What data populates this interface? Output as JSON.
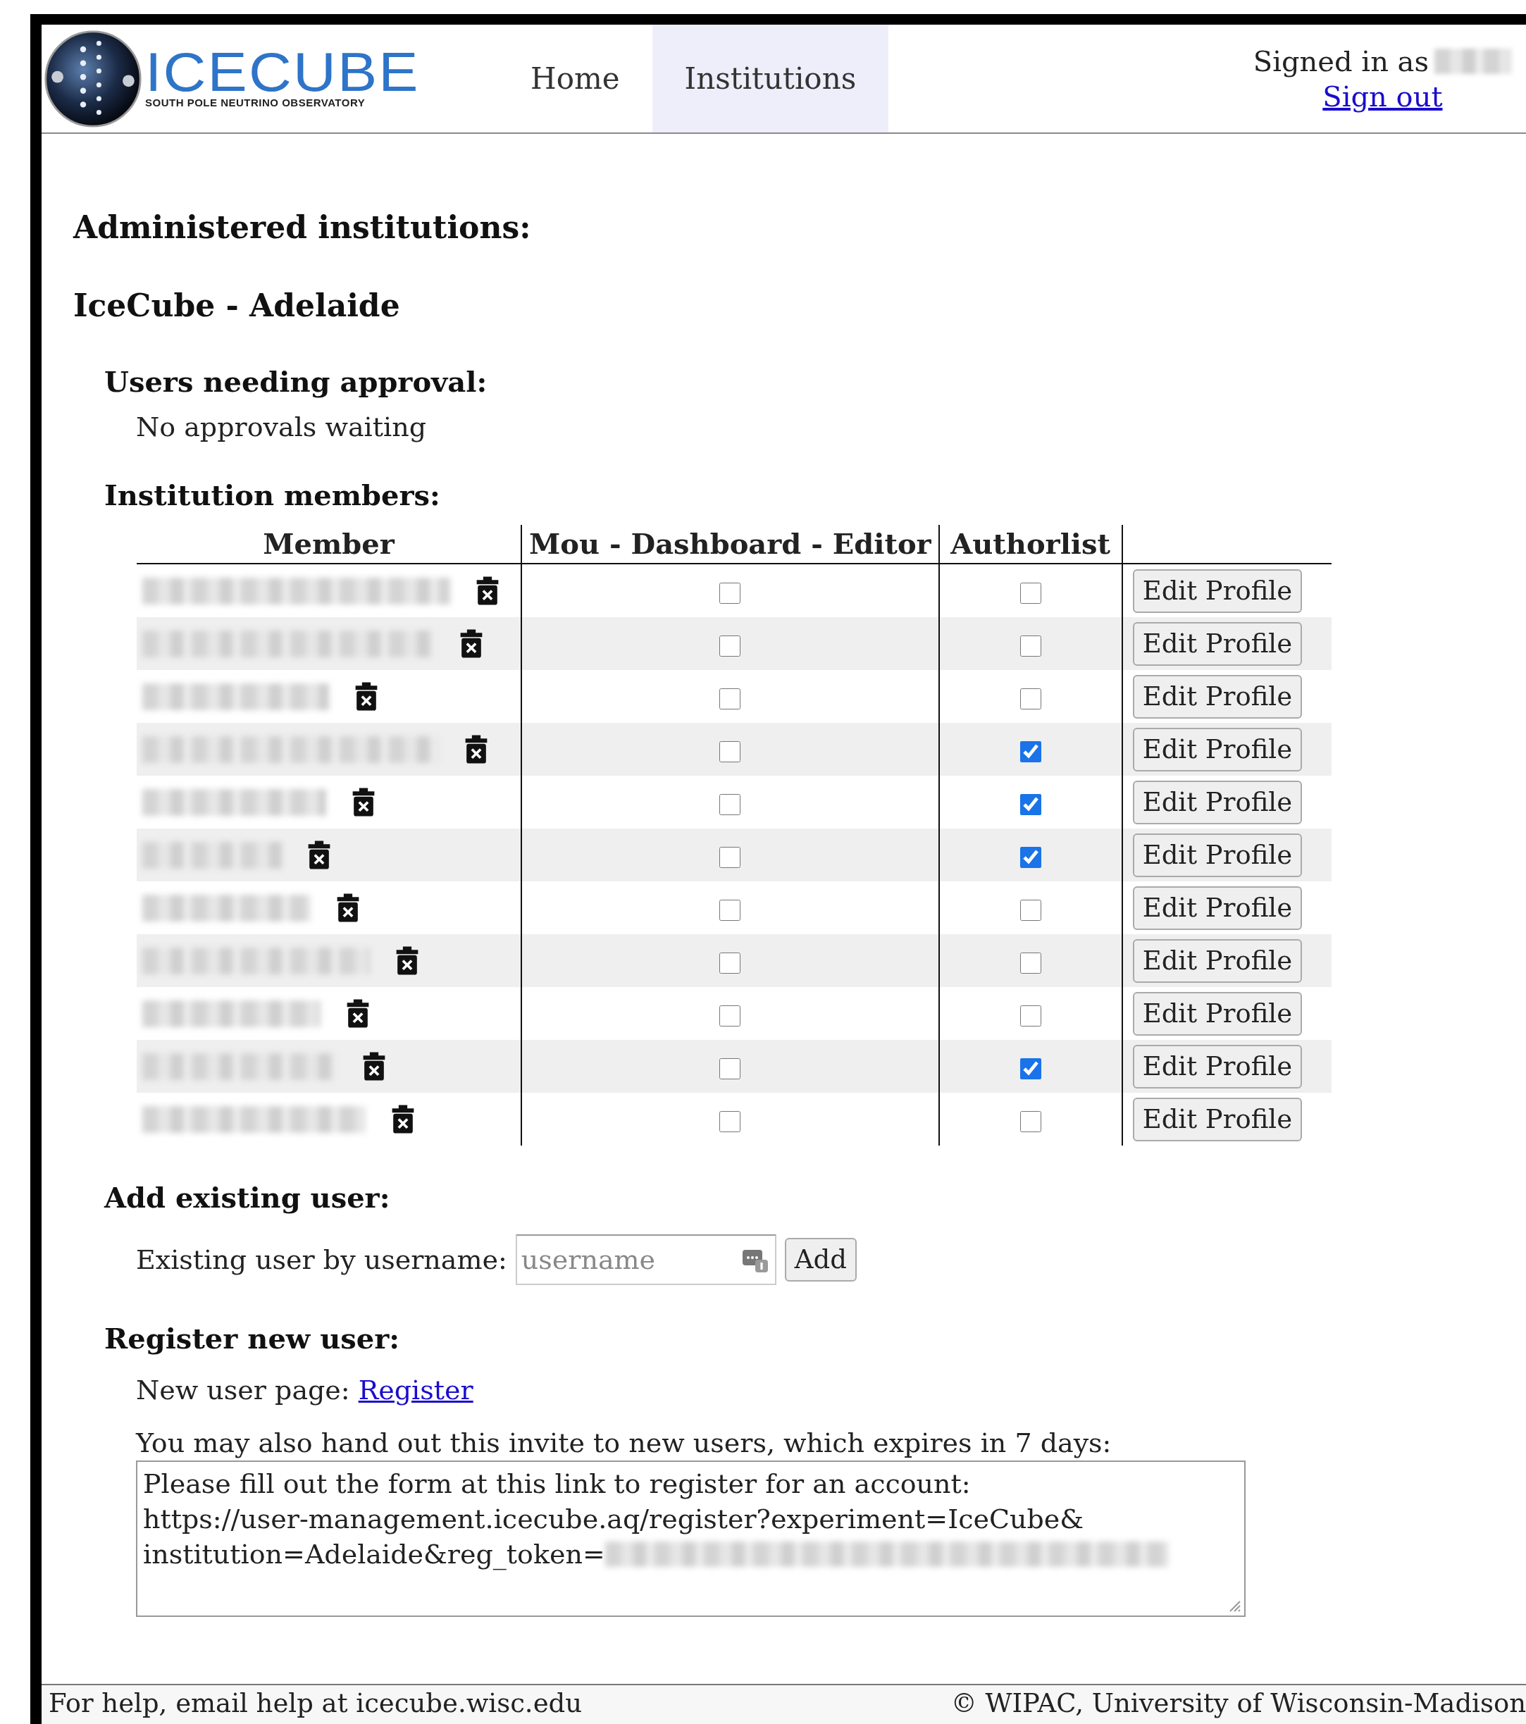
{
  "header": {
    "logo": {
      "title": "ICECUBE",
      "subtitle": "SOUTH POLE NEUTRINO OBSERVATORY"
    },
    "nav": [
      {
        "label": "Home",
        "selected": false
      },
      {
        "label": "Institutions",
        "selected": true
      }
    ],
    "signed_in_label": "Signed in as",
    "sign_out": "Sign out"
  },
  "page_title": "Administered institutions:",
  "institution": {
    "name": "IceCube - Adelaide",
    "approvals": {
      "heading": "Users needing approval:",
      "message": "No approvals waiting"
    },
    "members": {
      "heading": "Institution members:",
      "columns": [
        "Member",
        "Mou - Dashboard - Editor",
        "Authorlist"
      ],
      "rows": [
        {
          "mou_dashboard_editor": false,
          "authorlist": false,
          "action": "Edit Profile"
        },
        {
          "mou_dashboard_editor": false,
          "authorlist": false,
          "action": "Edit Profile"
        },
        {
          "mou_dashboard_editor": false,
          "authorlist": false,
          "action": "Edit Profile"
        },
        {
          "mou_dashboard_editor": false,
          "authorlist": true,
          "action": "Edit Profile"
        },
        {
          "mou_dashboard_editor": false,
          "authorlist": true,
          "action": "Edit Profile"
        },
        {
          "mou_dashboard_editor": false,
          "authorlist": true,
          "action": "Edit Profile"
        },
        {
          "mou_dashboard_editor": false,
          "authorlist": false,
          "action": "Edit Profile"
        },
        {
          "mou_dashboard_editor": false,
          "authorlist": false,
          "action": "Edit Profile"
        },
        {
          "mou_dashboard_editor": false,
          "authorlist": false,
          "action": "Edit Profile"
        },
        {
          "mou_dashboard_editor": false,
          "authorlist": true,
          "action": "Edit Profile"
        },
        {
          "mou_dashboard_editor": false,
          "authorlist": false,
          "action": "Edit Profile"
        }
      ]
    },
    "add_user": {
      "heading": "Add existing user:",
      "label": "Existing user by username:",
      "placeholder": "username",
      "button": "Add"
    },
    "register": {
      "heading": "Register new user:",
      "label": "New user page:",
      "link": "Register",
      "invite_note": "You may also hand out this invite to new users, which expires in 7 days:",
      "invite_lines": [
        "Please fill out the form at this link to register for an account:",
        "https://user-management.icecube.aq/register?experiment=IceCube&",
        "institution=Adelaide&reg_token="
      ]
    }
  },
  "footer": {
    "help": "For help, email help at icecube.wisc.edu",
    "copyright": "© WIPAC, University of Wisconsin-Madison"
  }
}
